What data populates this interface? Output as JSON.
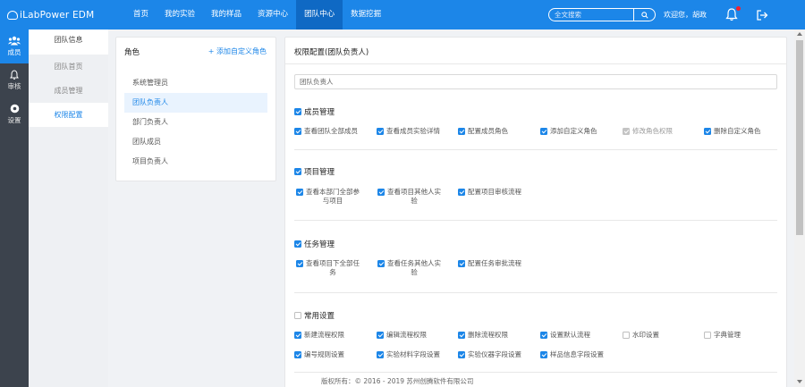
{
  "header": {
    "brand": "iLabPower EDM",
    "nav": [
      {
        "label": "首页",
        "active": false
      },
      {
        "label": "我的实验",
        "active": false
      },
      {
        "label": "我的样品",
        "active": false
      },
      {
        "label": "资源中心",
        "active": false
      },
      {
        "label": "团队中心",
        "active": true
      },
      {
        "label": "数据挖掘",
        "active": false
      }
    ],
    "search_placeholder": "全文搜索",
    "welcome": "欢迎您，胡政",
    "accent": "#1c86e8"
  },
  "rail": [
    {
      "label": "成员",
      "icon": "members-icon",
      "active": true
    },
    {
      "label": "审核",
      "icon": "bell-icon",
      "active": false
    },
    {
      "label": "设置",
      "icon": "gear-icon",
      "active": false
    }
  ],
  "submenu": {
    "head": "团队信息",
    "items": [
      {
        "label": "团队首页",
        "active": false
      },
      {
        "label": "成员管理",
        "active": false
      },
      {
        "label": "权限配置",
        "active": true
      }
    ]
  },
  "roles": {
    "title": "角色",
    "add_label": "+ 添加自定义角色",
    "items": [
      {
        "label": "系统管理员",
        "active": false
      },
      {
        "label": "团队负责人",
        "active": true
      },
      {
        "label": "部门负责人",
        "active": false
      },
      {
        "label": "团队成员",
        "active": false
      },
      {
        "label": "项目负责人",
        "active": false
      }
    ]
  },
  "permissions": {
    "title": "权限配置(团队负责人)",
    "role_name_value": "团队负责人",
    "sections": [
      {
        "title": "成员管理",
        "checked": true,
        "items": [
          {
            "label": "查看团队全部成员",
            "state": "on"
          },
          {
            "label": "查看成员实验详情",
            "state": "on"
          },
          {
            "label": "配置成员角色",
            "state": "on"
          },
          {
            "label": "添加自定义角色",
            "state": "on"
          },
          {
            "label": "修改角色权限",
            "state": "disabled"
          },
          {
            "label": "删除自定义角色",
            "state": "on"
          }
        ]
      },
      {
        "title": "项目管理",
        "checked": true,
        "items": [
          {
            "label_1": "查看本部门全部参",
            "label_2": "与项目",
            "state": "on"
          },
          {
            "label_1": "查看项目其他人实",
            "label_2": "验",
            "state": "on"
          },
          {
            "label": "配置项目审核流程",
            "state": "on"
          }
        ]
      },
      {
        "title": "任务管理",
        "checked": true,
        "items": [
          {
            "label_1": "查看项目下全部任",
            "label_2": "务",
            "state": "on"
          },
          {
            "label_1": "查看任务其他人实",
            "label_2": "验",
            "state": "on"
          },
          {
            "label": "配置任务审批流程",
            "state": "on"
          }
        ]
      },
      {
        "title": "常用设置",
        "checked": false,
        "items": [
          {
            "label": "新建流程权限",
            "state": "on"
          },
          {
            "label": "编辑流程权限",
            "state": "on"
          },
          {
            "label": "删除流程权限",
            "state": "on"
          },
          {
            "label": "设置默认流程",
            "state": "on"
          },
          {
            "label": "水印设置",
            "state": "off"
          },
          {
            "label": "字典管理",
            "state": "off"
          },
          {
            "label": "编号规则设置",
            "state": "on"
          },
          {
            "label": "实验材料字段设置",
            "state": "on"
          },
          {
            "label": "实验仪器字段设置",
            "state": "on"
          },
          {
            "label": "样品信息字段设置",
            "state": "on"
          }
        ]
      }
    ]
  },
  "footer": "版权所有：© 2016 - 2019 苏州创腾软件有限公司"
}
